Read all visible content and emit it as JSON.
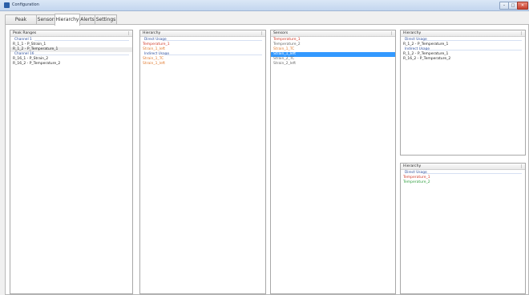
{
  "window": {
    "title": "Configuration"
  },
  "tabs": [
    {
      "label": "Peak Ranges"
    },
    {
      "label": "Sensors"
    },
    {
      "label": "Hierarchy"
    },
    {
      "label": "Alerts"
    },
    {
      "label": "Settings"
    }
  ],
  "active_tab": "Hierarchy",
  "peak_ranges_panel": {
    "title": "Peak Ranges",
    "groups": [
      {
        "label": "Channel 1",
        "items": [
          {
            "label": "R_1_1 - P_Strain_1"
          },
          {
            "label": "R_1_2 - P_Temperature_1"
          }
        ]
      },
      {
        "label": "Channel 16",
        "items": [
          {
            "label": "R_16_1 - P_Strain_2"
          },
          {
            "label": "R_16_2 - P_Temperature_2"
          }
        ]
      }
    ]
  },
  "hierarchy_panel_1": {
    "title": "Hierarchy",
    "groups": [
      {
        "label": "Direct Usage",
        "items": [
          {
            "label": "Temperature_1",
            "color": "#d23b2a"
          },
          {
            "label": "Strain_1_left",
            "color": "#e07a2e"
          }
        ]
      },
      {
        "label": "Indirect Usage",
        "items": [
          {
            "label": "Strain_1_TC",
            "color": "#e07a2e"
          },
          {
            "label": "Strain_1_left",
            "color": "#e07a2e"
          }
        ]
      }
    ]
  },
  "sensors_panel": {
    "title": "Sensors",
    "items": [
      {
        "label": "Temperature_1",
        "color": "#d23b2a"
      },
      {
        "label": "Temperature_2",
        "color": "#666666"
      },
      {
        "label": "Strain_1_TC",
        "color": "#e07a2e"
      },
      {
        "label": "Strain_1_left",
        "color": "#ffffff",
        "selected": true
      },
      {
        "label": "Strain_2_TC",
        "color": "#666666"
      },
      {
        "label": "Strain_2_left",
        "color": "#666666"
      }
    ]
  },
  "hierarchy_panel_2": {
    "title": "Hierarchy",
    "groups": [
      {
        "label": "Direct Usage",
        "items": [
          {
            "label": "R_1_2 - P_Temperature_1"
          }
        ]
      },
      {
        "label": "Indirect Usage",
        "items": [
          {
            "label": "R_1_2 - P_Temperature_1"
          },
          {
            "label": "R_16_2 - P_Temperature_2"
          }
        ]
      }
    ]
  },
  "hierarchy_panel_3": {
    "title": "Hierarchy",
    "groups": [
      {
        "label": "Direct Usage",
        "items": [
          {
            "label": "Temperature_1",
            "color": "#d23b2a"
          },
          {
            "label": "Temperature_2",
            "color": "#2f9e3f"
          }
        ]
      }
    ]
  },
  "colors": {
    "accent_selected": "#3399ff",
    "group_header": "#2c4f9e"
  }
}
